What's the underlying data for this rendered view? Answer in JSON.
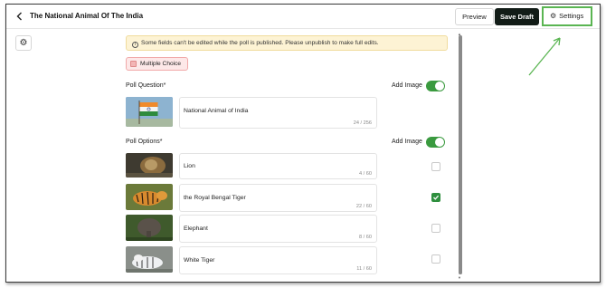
{
  "header": {
    "back_icon": "chevron-left-icon",
    "title": "The National Animal Of The India",
    "preview_label": "Preview",
    "save_label": "Save Draft",
    "settings_label": "Settings"
  },
  "notice": {
    "text": "Some fields can't be edited while the poll is published. Please unpublish to make full edits."
  },
  "poll_type": "Multiple Choice",
  "question": {
    "label": "Poll Question*",
    "add_image_label": "Add Image",
    "add_image_on": true,
    "value": "National Animal of India",
    "count": "24 / 256"
  },
  "options": {
    "label": "Poll Options*",
    "add_image_label": "Add Image",
    "add_image_on": true,
    "items": [
      {
        "value": "Lion",
        "count": "4 / 60",
        "correct": false
      },
      {
        "value": "the Royal Bengal Tiger",
        "count": "22 / 60",
        "correct": true
      },
      {
        "value": "Elephant",
        "count": "8 / 60",
        "correct": false
      },
      {
        "value": "White Tiger",
        "count": "11 / 60",
        "correct": false
      }
    ]
  },
  "colors": {
    "accent_green": "#3a9a3f",
    "save_button": "#121c17",
    "notice_bg": "#fdf3d4",
    "annotation_green": "#5ab552"
  }
}
